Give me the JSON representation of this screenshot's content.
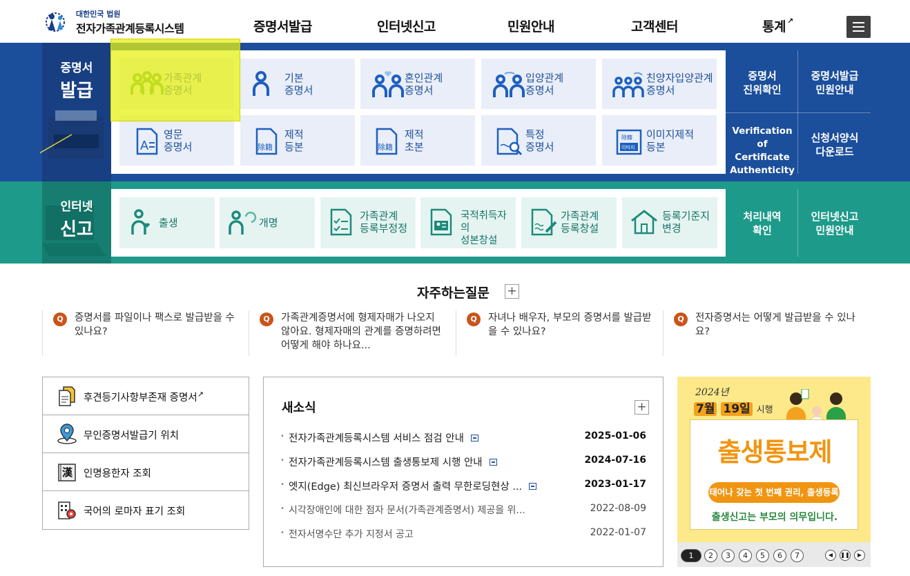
{
  "header": {
    "logo_sub": "대한민국 법원",
    "logo_main": "전자가족관계등록시스템",
    "nav": [
      {
        "label": "증명서발급"
      },
      {
        "label": "인터넷신고"
      },
      {
        "label": "민원안내"
      },
      {
        "label": "고객센터"
      },
      {
        "label": "통계"
      }
    ]
  },
  "cert": {
    "side_small": "증명서",
    "side_big": "발급",
    "buttons": [
      {
        "label": "가족관계\n증명서",
        "icon": "family-three-people-icon"
      },
      {
        "label": "기본\n증명서",
        "icon": "person-icon"
      },
      {
        "label": "혼인관계\n증명서",
        "icon": "couple-heart-icon"
      },
      {
        "label": "입양관계\n증명서",
        "icon": "adoption-couple-icon"
      },
      {
        "label": "친양자입양관계\n증명서",
        "icon": "adoption-family-icon"
      },
      {
        "label": "영문\n증명서",
        "icon": "english-document-icon"
      },
      {
        "label": "제적\n등본",
        "icon": "removed-register-icon"
      },
      {
        "label": "제적\n초본",
        "icon": "removed-register-icon"
      },
      {
        "label": "특정\n증명서",
        "icon": "document-search-icon"
      },
      {
        "label": "이미지제적\n등본",
        "icon": "image-register-icon"
      }
    ],
    "right_links": [
      {
        "label": "증명서\n진위확인"
      },
      {
        "label": "증명서발급\n민원안내"
      },
      {
        "label": "Verification of\nCertificate\nAuthenticity"
      },
      {
        "label": "신청서양식\n다운로드"
      }
    ]
  },
  "report": {
    "side_small": "인터넷",
    "side_big": "신고",
    "buttons": [
      {
        "label": "출생",
        "icon": "birth-icon"
      },
      {
        "label": "개명",
        "icon": "rename-icon"
      },
      {
        "label": "가족관계\n등록부정정",
        "icon": "checklist-document-icon"
      },
      {
        "label": "국적취득자의\n성본창설",
        "icon": "id-card-document-icon"
      },
      {
        "label": "가족관계\n등록창설",
        "icon": "write-document-icon"
      },
      {
        "label": "등록기준지\n변경",
        "icon": "house-icon"
      }
    ],
    "right_links": [
      {
        "label": "처리내역\n확인"
      },
      {
        "label": "인터넷신고\n민원안내"
      }
    ]
  },
  "faq": {
    "title": "자주하는질문",
    "q_badge": "Q",
    "items": [
      {
        "text": "증명서를 파일이나 팩스로 발급받을 수 있나요?"
      },
      {
        "text": "가족관계증명서에 형제자매가 나오지 않아요. 형제자매의 관계를 증명하려면 어떻게 해야 하나요..."
      },
      {
        "text": "자녀나 배우자, 부모의 증명서를 발급받을 수 있나요?"
      },
      {
        "text": "전자증명서는 어떻게 발급받을 수 있나요?"
      }
    ]
  },
  "quick_links": [
    {
      "label": "후견등기사항부존재 증명서",
      "icon": "document-stack-icon",
      "external": true
    },
    {
      "label": "무인증명서발급기 위치",
      "icon": "location-pin-icon",
      "external": false
    },
    {
      "label": "인명용한자 조회",
      "icon": "hanja-book-icon",
      "external": false
    },
    {
      "label": "국어의 로마자 표기 조회",
      "icon": "building-search-icon",
      "external": false
    }
  ],
  "news": {
    "title": "새소식",
    "items": [
      {
        "title": "전자가족관계등록시스템 서비스 점검 안내",
        "date": "2025-01-06",
        "is_new": true
      },
      {
        "title": "전자가족관계등록시스템 출생통보제 시행 안내",
        "date": "2024-07-16",
        "is_new": true
      },
      {
        "title": "엣지(Edge) 최신브라우저 증명서 출력 무한로딩현상 ...",
        "date": "2023-01-17",
        "is_new": true
      },
      {
        "title": "시각장애인에 대한 점자 문서(가족관계증명서) 제공을 위...",
        "date": "2022-08-09",
        "is_new": false
      },
      {
        "title": "전자서명수단 추가 지정서 공고",
        "date": "2022-01-07",
        "is_new": false
      }
    ]
  },
  "banner": {
    "year": "2024년",
    "date_month": "7월",
    "date_day": "19일",
    "date_suffix": "시행",
    "headline": "출생통보제",
    "pill": "태어나 갖는 첫 번째 권리, 출생등록",
    "tagline": "출생신고는 부모의 의무입니다.",
    "pages": [
      "1",
      "2",
      "3",
      "4",
      "5",
      "6",
      "7"
    ],
    "active_page": "1"
  },
  "colors": {
    "cert_band": "#1b4e9b",
    "report_band": "#1d9a8a",
    "highlight": "#e6f014",
    "faq_badge": "#c9541b",
    "banner_bg": "#fde98a"
  }
}
